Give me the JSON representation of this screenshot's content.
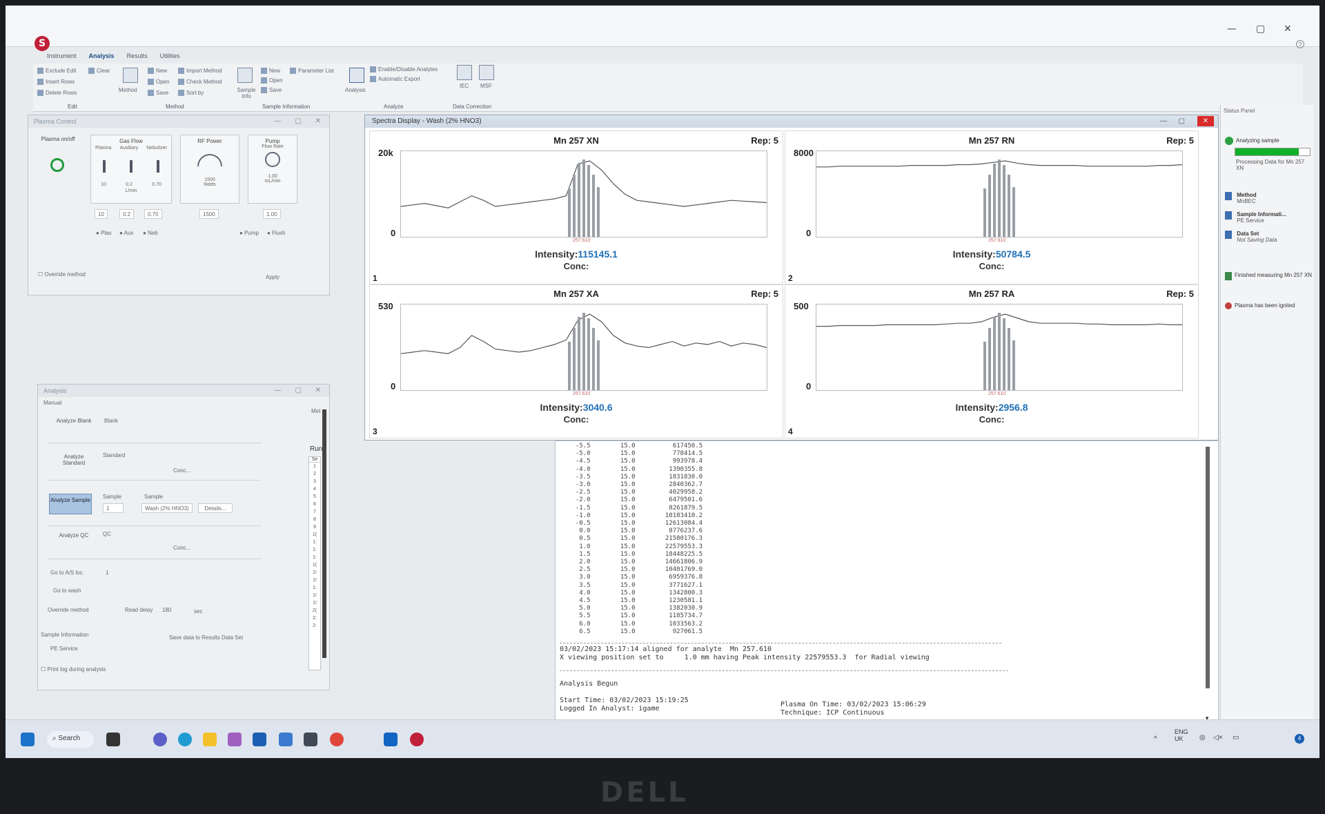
{
  "window": {
    "minimize": "—",
    "maximize": "▢",
    "close": "✕",
    "help": "?"
  },
  "ribbon": {
    "tabs": [
      "Instrument",
      "Analysis",
      "Results",
      "Utilities"
    ],
    "edit": {
      "items": [
        "Exclude Edit",
        "Clear",
        "Insert Rows",
        "Delete Rows"
      ],
      "group": "Edit"
    },
    "method": {
      "big": "Method",
      "items": [
        "New",
        "Open",
        "Save",
        "Import Method",
        "Check Method",
        "Sort by"
      ],
      "group": "Method"
    },
    "sample_info": {
      "big": "Sample Info",
      "items": [
        "New",
        "Open",
        "Save",
        "Parameter List"
      ],
      "group": "Sample Information"
    },
    "analyze": {
      "big": "Analysis",
      "items": [
        "Enable/Disable Analytes",
        "Automatic Export"
      ],
      "group": "Analyze"
    },
    "data_correction": {
      "items": [
        "IEC",
        "MSF"
      ],
      "group": "Data Correction"
    }
  },
  "plasma": {
    "title": "Plasma Control",
    "onoff": "Plasma on/off",
    "gas_flow": "Gas Flow",
    "gas_cols": [
      "Plasma",
      "Auxiliary",
      "Nebulizer"
    ],
    "gas_vals": [
      "10",
      "0.2",
      "0.70"
    ],
    "gas_unit": "L/min",
    "rf_title": "RF Power",
    "rf_val": "1500",
    "rf_unit": "Watts",
    "pump_title": "Pump",
    "pump_sub": "Flow Rate",
    "pump_val": "1.00",
    "pump_unit": "mL/min",
    "spin_gas": [
      "10",
      "0.2",
      "0.70"
    ],
    "spin_rf": "1500",
    "spin_pump": "1.00",
    "radios_gas": [
      "Plas",
      "Aux",
      "Neb"
    ],
    "radios_pump": [
      "Pump",
      "Flush"
    ],
    "override": "Override method",
    "apply": "Apply"
  },
  "analysis": {
    "title": "Analysis",
    "manual": "Manual",
    "analyze_blank": "Analyze Blank",
    "blank": "Blank",
    "analyze_standard": "Analyze Standard",
    "standard": "Standard",
    "conc": "Conc...",
    "analyze_sample": "Analyze Sample",
    "sample": "Sample",
    "sample_no": "1",
    "sample_id": "Wash (2% HNO3)",
    "details": "Details...",
    "analyze_qc": "Analyze QC",
    "qc": "QC",
    "go_to_as": "Go to A/S loc.",
    "as_loc": "1",
    "go_to_wash": "Go to wash",
    "override_method": "Override method",
    "read_delay": "Read delay",
    "read_delay_val": "180",
    "sec": "sec",
    "sample_information": "Sample Information",
    "save_data": "Save data to Results Data Set",
    "pe_service": "PE Service",
    "print_log": "Print log during analysis",
    "run_header": "Run",
    "side_header": "Met",
    "seq_header": "Se",
    "run_rows": [
      "1",
      "2",
      "3",
      "4",
      "5",
      "6",
      "7",
      "8",
      "9",
      "1(",
      "1:",
      "1:",
      "1:",
      "1(",
      "1!",
      "1!",
      "1:",
      "1!",
      "1!",
      "2(",
      "2:",
      "2:"
    ]
  },
  "spectra": {
    "title": "Spectra Display - Wash (2% HNO3)",
    "intensity_label": "Intensity:",
    "conc_label": "Conc:",
    "x_tick": "257.610",
    "panels": [
      {
        "num": "1",
        "title": "Mn 257 XN",
        "rep": "Rep: 5",
        "ymax": "20k",
        "ymin": "0",
        "intensity": "115145.1"
      },
      {
        "num": "2",
        "title": "Mn 257 RN",
        "rep": "Rep: 5",
        "ymax": "8000",
        "ymin": "0",
        "intensity": "50784.5"
      },
      {
        "num": "3",
        "title": "Mn 257 XA",
        "rep": "Rep: 5",
        "ymax": "530",
        "ymin": "0",
        "intensity": "3040.6"
      },
      {
        "num": "4",
        "title": "Mn 257 RA",
        "rep": "Rep: 5",
        "ymax": "500",
        "ymin": "0",
        "intensity": "2956.8"
      }
    ]
  },
  "log": {
    "rows": [
      [
        "-5.5",
        "15.0",
        "617450.5"
      ],
      [
        "-5.0",
        "15.0",
        "778414.5"
      ],
      [
        "-4.5",
        "15.0",
        "993978.4"
      ],
      [
        "-4.0",
        "15.0",
        "1390355.8"
      ],
      [
        "-3.5",
        "15.0",
        "1831830.0"
      ],
      [
        "-3.0",
        "15.0",
        "2840362.7"
      ],
      [
        "-2.5",
        "15.0",
        "4029958.2"
      ],
      [
        "-2.0",
        "15.0",
        "6479501.6"
      ],
      [
        "-1.5",
        "15.0",
        "8261879.5"
      ],
      [
        "-1.0",
        "15.0",
        "10183410.2"
      ],
      [
        "-0.5",
        "15.0",
        "12613084.4"
      ],
      [
        "0.0",
        "15.0",
        "8776237.6"
      ],
      [
        "0.5",
        "15.0",
        "21580176.3"
      ],
      [
        "1.0",
        "15.0",
        "22579553.3"
      ],
      [
        "1.5",
        "15.0",
        "18448225.5"
      ],
      [
        "2.0",
        "15.0",
        "14661806.9"
      ],
      [
        "2.5",
        "15.0",
        "10401769.0"
      ],
      [
        "3.0",
        "15.0",
        "6959376.8"
      ],
      [
        "3.5",
        "15.0",
        "3771627.1"
      ],
      [
        "4.0",
        "15.0",
        "1342800.3"
      ],
      [
        "4.5",
        "15.0",
        "1230581.1"
      ],
      [
        "5.0",
        "15.0",
        "1382030.9"
      ],
      [
        "5.5",
        "15.0",
        "1185734.7"
      ],
      [
        "6.0",
        "15.0",
        "1033563.2"
      ],
      [
        "6.5",
        "15.0",
        "927061.5"
      ]
    ],
    "aligned": "03/02/2023 15:17:14 aligned for analyte  Mn 257.610",
    "viewing": "X viewing position set to     1.0 mm having Peak intensity 22579553.3  for Radial viewing",
    "begun": "Analysis Begun",
    "start": "Start Time: 03/02/2023 15:19:25",
    "logged": "Logged In Analyst: igame",
    "plasma_on": "Plasma On Time: 03/02/2023 15:06:29",
    "technique": "Technique: ICP Continuous"
  },
  "status": {
    "title": "Status Panel",
    "analyzing": "Analyzing sample",
    "processing": "Processing Data for Mn 257 XN",
    "method_label": "Method",
    "method_val": "MnBEC",
    "sample_info_label": "Sample Informati...",
    "sample_info_val": "PE Service",
    "data_set_label": "Data Set",
    "data_set_val": "Not Saving Data",
    "finished": "Finished measuring Mn 257 XN",
    "plasma_ignited": "Plasma has been ignited",
    "progress": 0.85
  },
  "taskbar": {
    "search": "Search",
    "lang1": "ENG",
    "lang2": "UK",
    "notif": "4"
  },
  "bezel": "DELL"
}
